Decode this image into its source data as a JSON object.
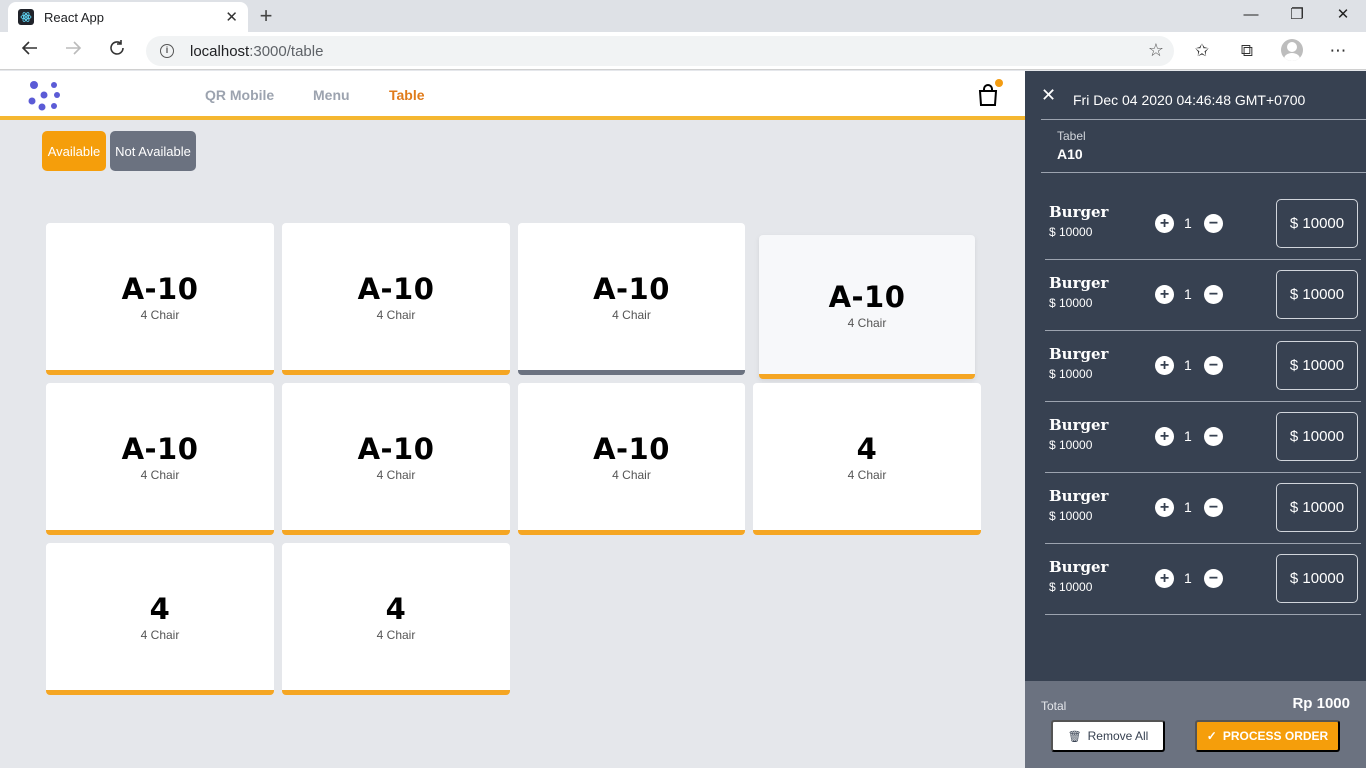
{
  "browser": {
    "tab_title": "React App",
    "tab_close": "✕",
    "new_tab": "+",
    "url_host": "localhost",
    "url_path": ":3000/table",
    "controls": {
      "minimize": "—",
      "maximize": "❐",
      "close": "✕"
    }
  },
  "nav": {
    "links": [
      "QR Mobile",
      "Menu",
      "Table"
    ],
    "active": "Table"
  },
  "filters": {
    "available": "Available",
    "not_available": "Not Available"
  },
  "tables": [
    {
      "name": "A-10",
      "chairs": "4 Chair",
      "status": "available"
    },
    {
      "name": "A-10",
      "chairs": "4 Chair",
      "status": "available"
    },
    {
      "name": "A-10",
      "chairs": "4 Chair",
      "status": "not-available"
    },
    {
      "name": "A-10",
      "chairs": "4 Chair",
      "status": "available"
    },
    {
      "name": "A-10",
      "chairs": "4 Chair",
      "status": "available"
    },
    {
      "name": "A-10",
      "chairs": "4 Chair",
      "status": "available"
    },
    {
      "name": "A-10",
      "chairs": "4 Chair",
      "status": "available"
    },
    {
      "name": "4",
      "chairs": "4 Chair",
      "status": "available"
    },
    {
      "name": "4",
      "chairs": "4 Chair",
      "status": "available"
    },
    {
      "name": "4",
      "chairs": "4 Chair",
      "status": "available"
    }
  ],
  "order": {
    "date": "Fri Dec 04 2020 04:46:48 GMT+0700",
    "table_label": "Tabel",
    "table_value": "A10",
    "items": [
      {
        "name": "Burger",
        "price": "$ 10000",
        "qty": "1",
        "amount": "$ 10000"
      },
      {
        "name": "Burger",
        "price": "$ 10000",
        "qty": "1",
        "amount": "$ 10000"
      },
      {
        "name": "Burger",
        "price": "$ 10000",
        "qty": "1",
        "amount": "$ 10000"
      },
      {
        "name": "Burger",
        "price": "$ 10000",
        "qty": "1",
        "amount": "$ 10000"
      },
      {
        "name": "Burger",
        "price": "$ 10000",
        "qty": "1",
        "amount": "$ 10000"
      },
      {
        "name": "Burger",
        "price": "$ 10000",
        "qty": "1",
        "amount": "$ 10000"
      }
    ],
    "total_label": "Total",
    "total_value": "Rp 1000",
    "remove_all": "Remove All",
    "process_order": "PROCESS ORDER"
  },
  "colors": {
    "accent": "#f59e0b",
    "active_link": "#e07b1a",
    "panel_bg": "#374151",
    "unavailable": "#6b7280"
  }
}
